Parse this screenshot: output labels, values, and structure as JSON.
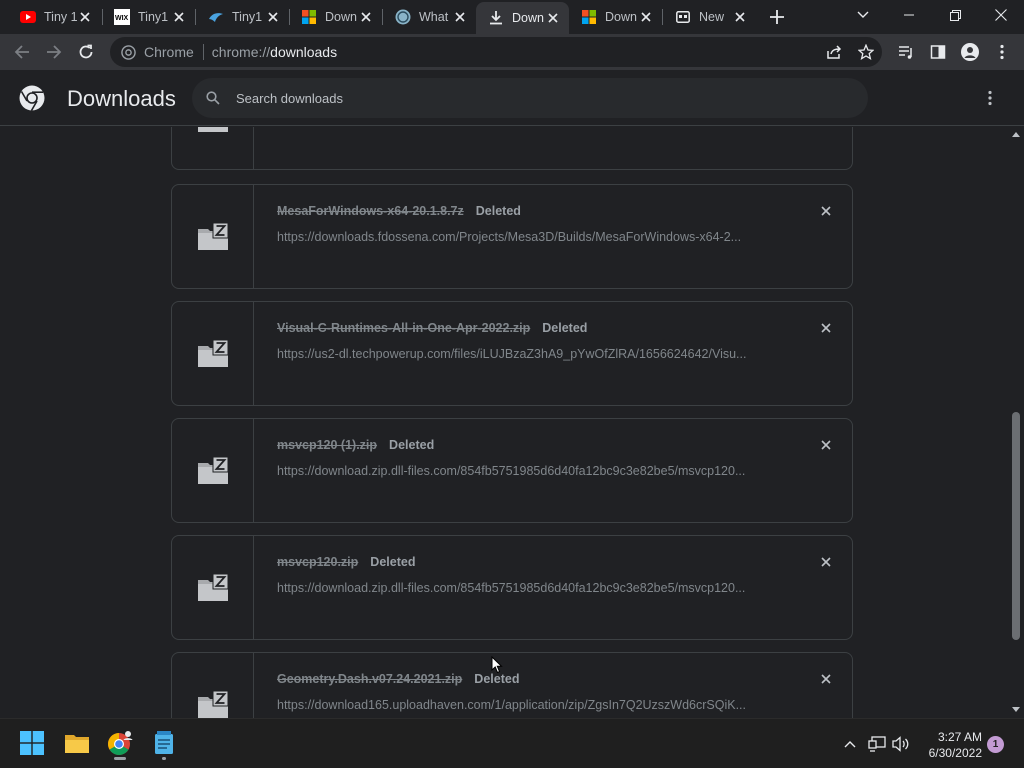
{
  "tabs": [
    {
      "title": "Tiny 1",
      "favicon": "youtube-icon"
    },
    {
      "title": "Tiny1",
      "favicon": "wix-icon"
    },
    {
      "title": "Tiny1",
      "favicon": "tinywow-icon"
    },
    {
      "title": "Down",
      "favicon": "microsoft-icon"
    },
    {
      "title": "What",
      "favicon": "whatsapp-icon"
    },
    {
      "title": "Down",
      "favicon": "download-icon",
      "active": true
    },
    {
      "title": "Down",
      "favicon": "microsoft-icon"
    },
    {
      "title": "New",
      "favicon": "newtab-icon"
    }
  ],
  "omnibox": {
    "chip": "Chrome",
    "url_scheme": "chrome://",
    "url_host": "downloads"
  },
  "header": {
    "title": "Downloads",
    "search_placeholder": "Search downloads"
  },
  "downloads": [
    {
      "name": "",
      "status": "",
      "url": ""
    },
    {
      "name": "MesaForWindows-x64-20.1.8.7z",
      "status": "Deleted",
      "url": "https://downloads.fdossena.com/Projects/Mesa3D/Builds/MesaForWindows-x64-2..."
    },
    {
      "name": "Visual-C-Runtimes-All-in-One-Apr-2022.zip",
      "status": "Deleted",
      "url": "https://us2-dl.techpowerup.com/files/iLUJBzaZ3hA9_pYwOfZlRA/1656624642/Visu..."
    },
    {
      "name": "msvcp120 (1).zip",
      "status": "Deleted",
      "url": "https://download.zip.dll-files.com/854fb5751985d6d40fa12bc9c3e82be5/msvcp120..."
    },
    {
      "name": "msvcp120.zip",
      "status": "Deleted",
      "url": "https://download.zip.dll-files.com/854fb5751985d6d40fa12bc9c3e82be5/msvcp120..."
    },
    {
      "name": "Geometry.Dash.v07.24.2021.zip",
      "status": "Deleted",
      "url": "https://download165.uploadhaven.com/1/application/zip/ZgsIn7Q2UzszWd6crSQiK..."
    }
  ],
  "taskbar": {
    "time": "3:27 AM",
    "date": "6/30/2022",
    "notifications": "1"
  },
  "colors": {
    "background": "#202124",
    "toolbar": "#35363a",
    "card_border": "#3c4043",
    "text_primary": "#e8eaed",
    "text_muted": "#80868b"
  }
}
